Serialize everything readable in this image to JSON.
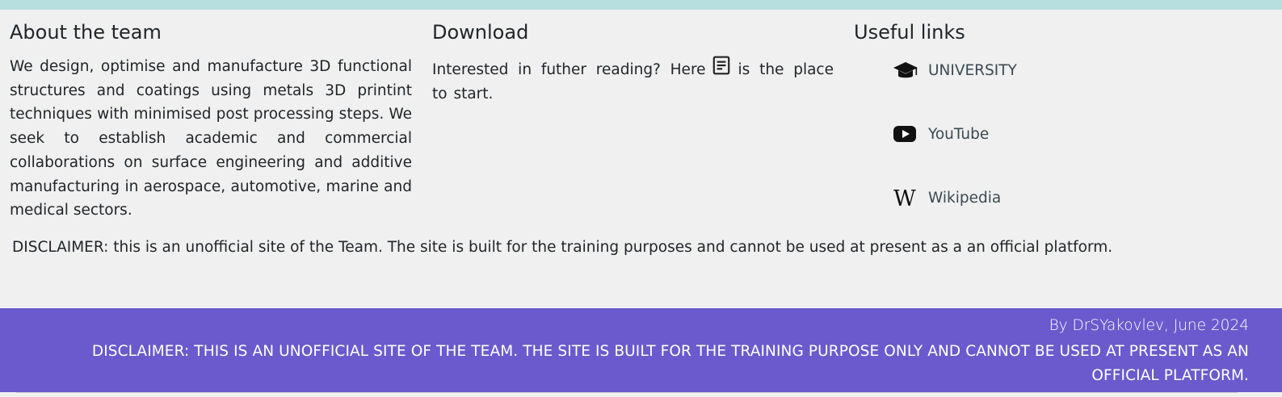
{
  "about": {
    "title": "About the team",
    "text": "We design, optimise and manufacture 3D functional structures and coatings using metals 3D printint techniques with minimised post processing steps. We seek to establish academic and commercial collaborations on surface engineering and additive manufacturing in aerospace, automotive, marine and medical sectors."
  },
  "download": {
    "title": "Download",
    "text_before": "Interested in futher reading? Here",
    "icon": "document-icon",
    "text_after": "is the place to start."
  },
  "links": {
    "title": "Useful links",
    "items": [
      {
        "label": "UNIVERSITY",
        "icon": "graduation-cap-icon"
      },
      {
        "label": "YouTube",
        "icon": "youtube-icon"
      },
      {
        "label": "Wikipedia",
        "icon": "wikipedia-icon"
      }
    ]
  },
  "disclaimer_mid": "DISCLAIMER: this is an unofficial site of the Team. The site is built for the training purposes and cannot be used at present as a an official platform.",
  "footer": {
    "by": "By DrSYakovlev, June 2024",
    "disclaimer": "DISCLAIMER: THIS IS AN UNOFFICIAL SITE OF THE TEAM. THE SITE IS BUILT FOR THE TRAINING PURPOSE ONLY AND CANNOT BE USED AT PRESENT AS AN OFFICIAL PLATFORM."
  },
  "colors": {
    "top_strip": "#b7dfe0",
    "background": "#f0f0f0",
    "footer": "#6a5acd"
  }
}
